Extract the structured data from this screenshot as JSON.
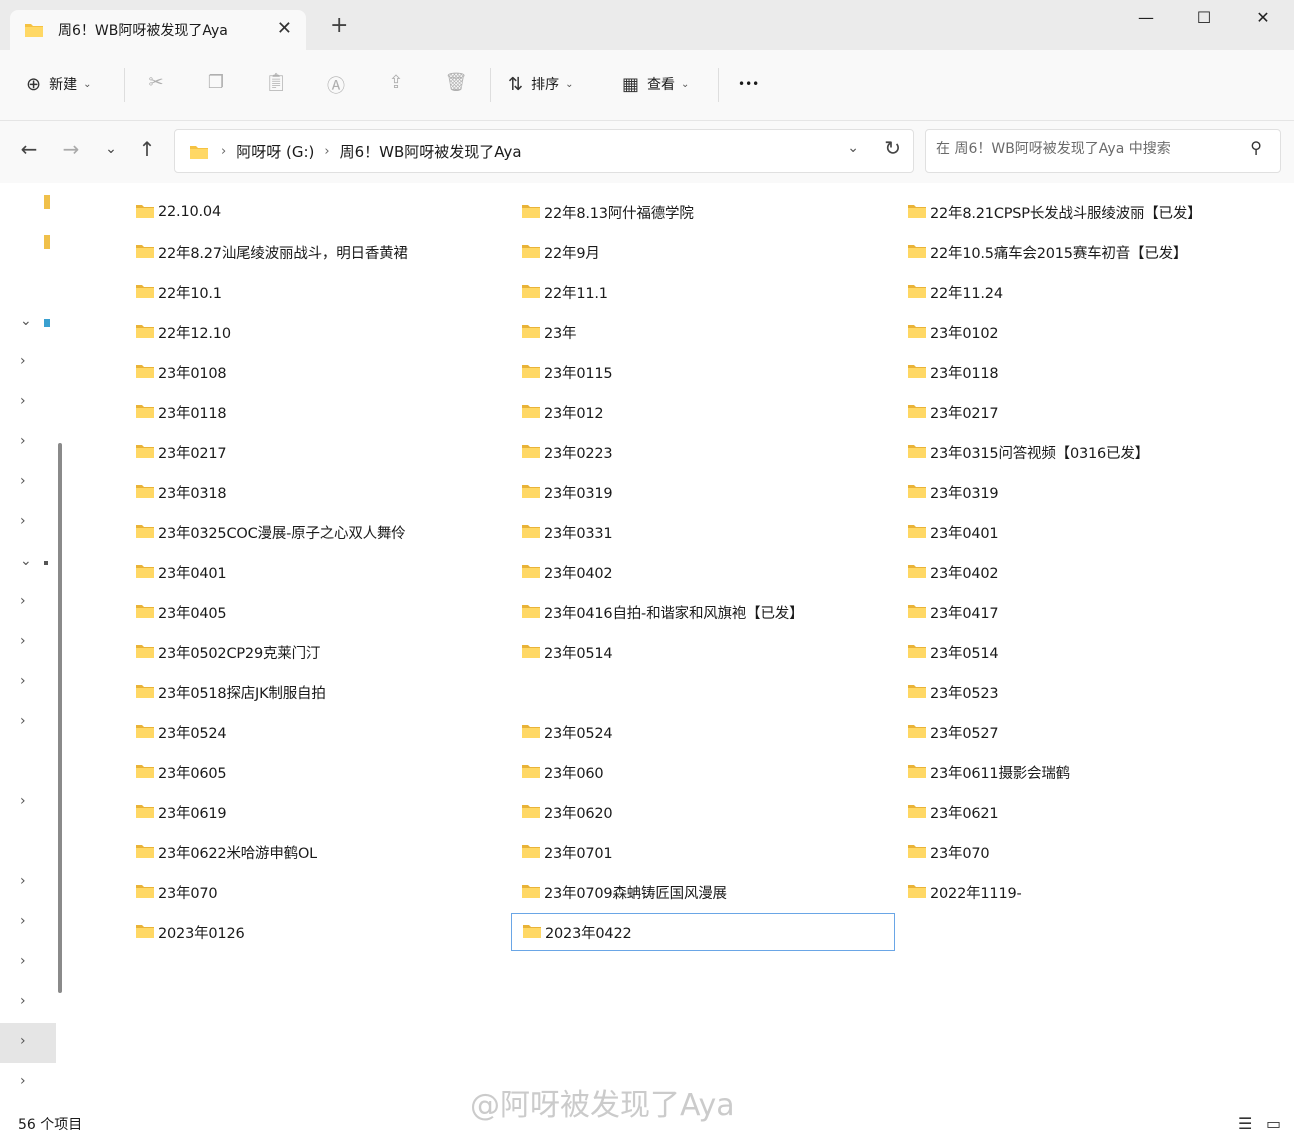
{
  "window": {
    "tab_title": "周6！WB阿呀被发现了Aya",
    "new_tab_label": "+",
    "minimize": "—",
    "maximize": "☐",
    "close": "✕"
  },
  "toolbar": {
    "new_label": "新建",
    "sort_label": "排序",
    "view_label": "查看",
    "more_label": "•••"
  },
  "address": {
    "crumbs": [
      "阿呀呀 (G:)",
      "周6！WB阿呀被发现了Aya"
    ]
  },
  "search": {
    "placeholder": "在 周6！WB阿呀被发现了Aya 中搜索"
  },
  "files": [
    [
      "22.10.04",
      "22年8.13阿什福德学院",
      "22年8.21CPSP长发战斗服绫波丽【已发】"
    ],
    [
      "22年8.27汕尾绫波丽战斗，明日香黄裙",
      "22年9月",
      "22年10.5痛车会2015赛车初音【已发】"
    ],
    [
      "22年10.1",
      "22年11.1",
      "22年11.24"
    ],
    [
      "22年12.10",
      "23年",
      "23年0102"
    ],
    [
      "23年0108",
      "23年0115",
      "23年0118"
    ],
    [
      "23年0118",
      "23年012",
      "23年0217"
    ],
    [
      "23年0217",
      "23年0223",
      "23年0315问答视频【0316已发】"
    ],
    [
      "23年0318",
      "23年0319",
      "23年0319"
    ],
    [
      "23年0325COC漫展-原子之心双人舞伶",
      "23年0331",
      "23年0401"
    ],
    [
      "23年0401",
      "23年0402",
      "23年0402"
    ],
    [
      "23年0405",
      "23年0416自拍-和谐家和风旗袍【已发】",
      "23年0417"
    ],
    [
      "23年0502CP29克莱门汀",
      "23年0514",
      "23年0514"
    ],
    [
      "23年0518探店JK制服自拍",
      "",
      "23年0523"
    ],
    [
      "23年0524",
      "23年0524",
      "23年0527"
    ],
    [
      "23年0605",
      "23年060",
      "23年0611摄影会瑞鹤"
    ],
    [
      "23年0619",
      "23年0620",
      "23年0621"
    ],
    [
      "23年0622米哈游申鹤OL",
      "23年0701",
      "23年070"
    ],
    [
      "23年070",
      "23年0709森蚺铸匠国风漫展",
      "2022年1119-"
    ],
    [
      "2023年0126",
      "2023年0422"
    ]
  ],
  "status": {
    "item_count": "56 个项目"
  },
  "watermark": "@阿呀被发现了Aya"
}
